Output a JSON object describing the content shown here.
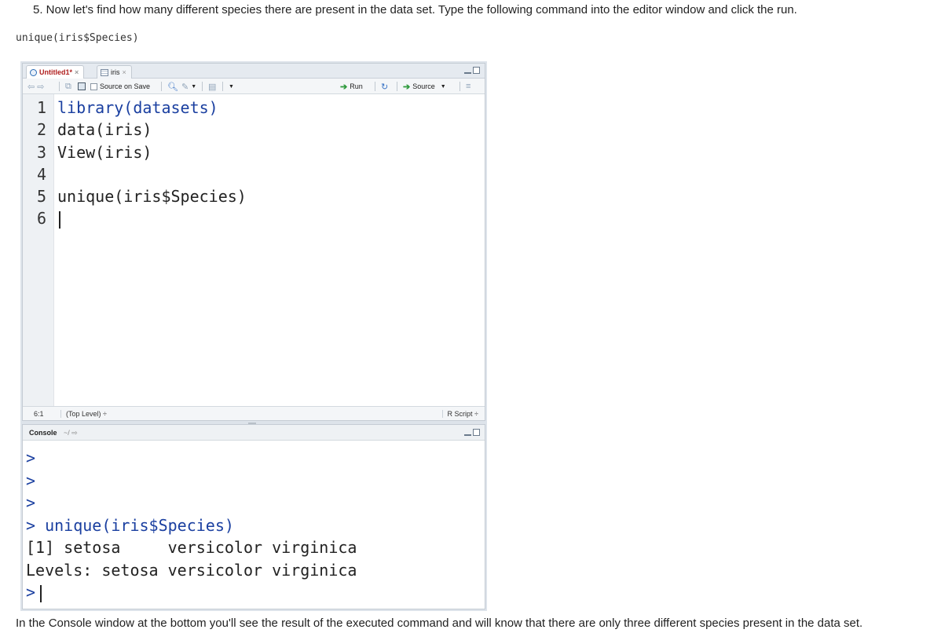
{
  "instruction": "5. Now let's find how many different species there are present in the data set. Type the following command into the editor window and click the run.",
  "code_snippet": "unique(iris$Species)",
  "editor": {
    "tabs": [
      {
        "label": "Untitled1*",
        "close": "×"
      },
      {
        "label": "iris",
        "close": "×"
      }
    ],
    "toolbar": {
      "source_on_save": "Source on Save",
      "run": "Run",
      "source": "Source"
    },
    "lines": [
      {
        "num": "1",
        "text": "library(datasets)"
      },
      {
        "num": "2",
        "text": "data(iris)"
      },
      {
        "num": "3",
        "text": "View(iris)"
      },
      {
        "num": "4",
        "text": ""
      },
      {
        "num": "5",
        "text": "unique(iris$Species)"
      },
      {
        "num": "6",
        "text": ""
      }
    ],
    "status": {
      "position": "6:1",
      "level": "(Top Level) ÷",
      "file_type": "R Script ÷"
    }
  },
  "console": {
    "title": "Console",
    "path": "~/",
    "lines": [
      ">",
      ">",
      ">",
      "> unique(iris$Species)",
      "[1] setosa     versicolor virginica",
      "Levels: setosa versicolor virginica",
      ">"
    ]
  },
  "footer": "In the Console window at the bottom you'll see the result of the executed command and will know that there are only three different species present in the data set.",
  "colors": {
    "code_keyword": "#1a3fa0",
    "active_tab": "#b02020",
    "run_arrow": "#2e9a3c"
  }
}
